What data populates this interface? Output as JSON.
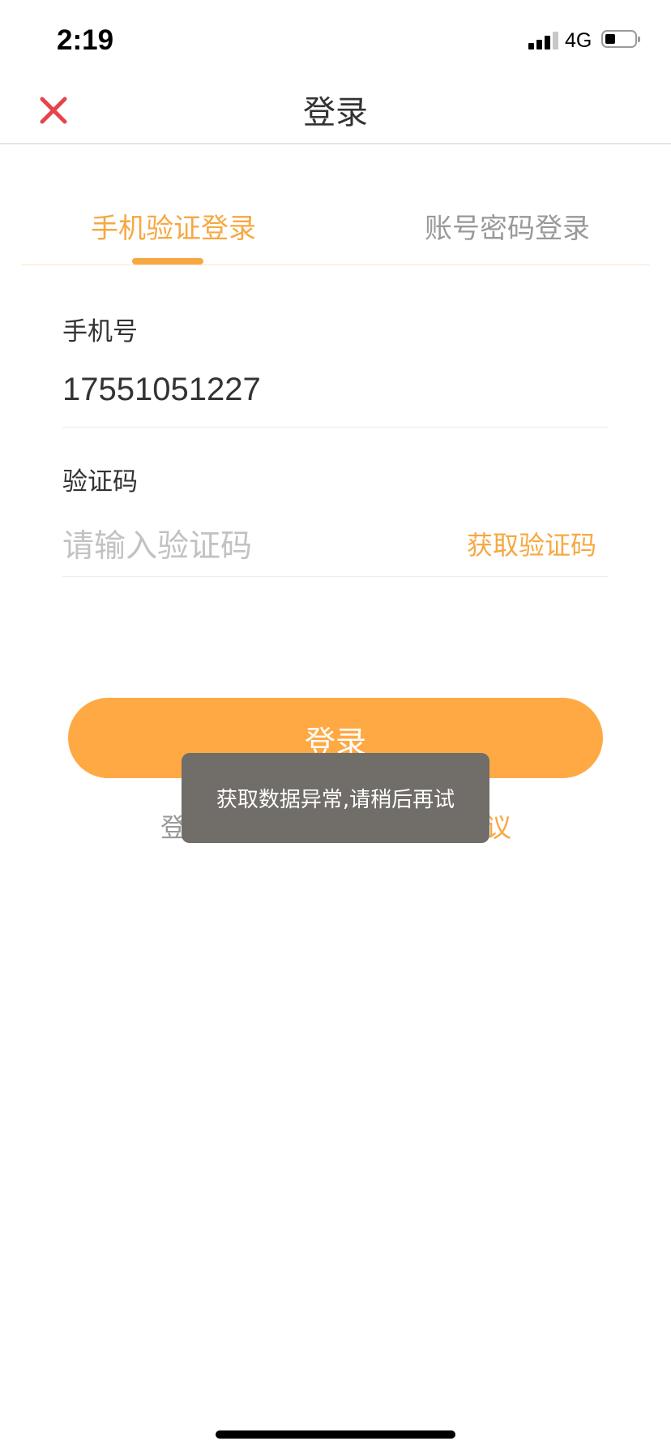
{
  "status_bar": {
    "time": "2:19",
    "network": "4G",
    "signal_bars_filled": 3,
    "signal_bars_total": 4,
    "battery_level": 0.3
  },
  "nav": {
    "title": "登录",
    "close_icon": "close-icon",
    "close_color": "#e8434b"
  },
  "tabs": [
    {
      "label": "手机验证登录",
      "active": true
    },
    {
      "label": "账号密码登录",
      "active": false
    }
  ],
  "form": {
    "phone": {
      "label": "手机号",
      "value": "17551051227"
    },
    "code": {
      "label": "验证码",
      "placeholder": "请输入验证码",
      "action": "获取验证码"
    }
  },
  "login_button": {
    "label": "登录"
  },
  "agreement": {
    "visible_start": "登",
    "visible_end": "议"
  },
  "toast": {
    "message": "获取数据异常,请稍后再试"
  },
  "colors": {
    "accent": "#f7a843",
    "button": "#ffa944",
    "toast_bg": "#716d68"
  }
}
